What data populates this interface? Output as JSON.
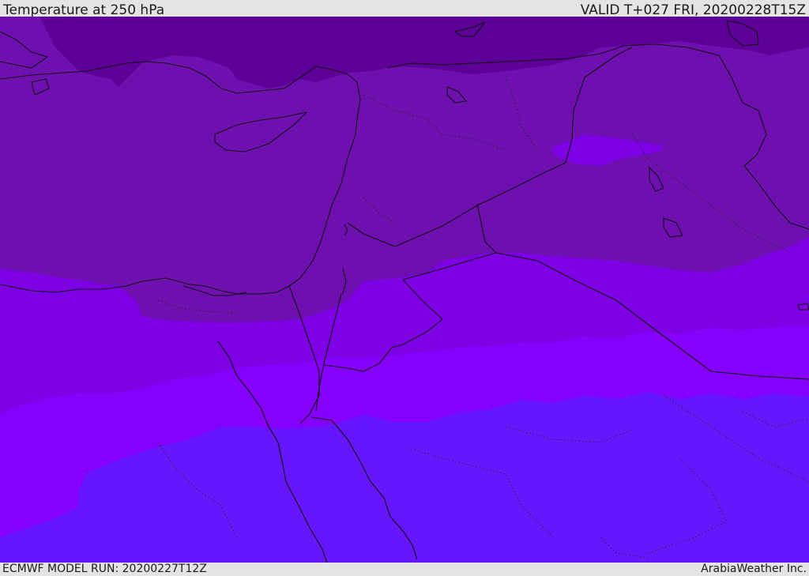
{
  "header": {
    "title": "Temperature at 250 hPa",
    "valid": "VALID T+027 FRI, 20200228T15Z"
  },
  "footer": {
    "model_run": "ECMWF MODEL RUN: 20200227T12Z",
    "credit": "ArabiaWeather Inc."
  },
  "map": {
    "field": "temperature-250hPa",
    "region": "Eastern Mediterranean / Middle East",
    "colors": {
      "band_darkest": "#5c0098",
      "band_dark": "#6e10b0",
      "band_mid": "#7e00e4",
      "band_bright": "#8600fe",
      "band_blue": "#6616ff",
      "borders": "#111111"
    }
  }
}
